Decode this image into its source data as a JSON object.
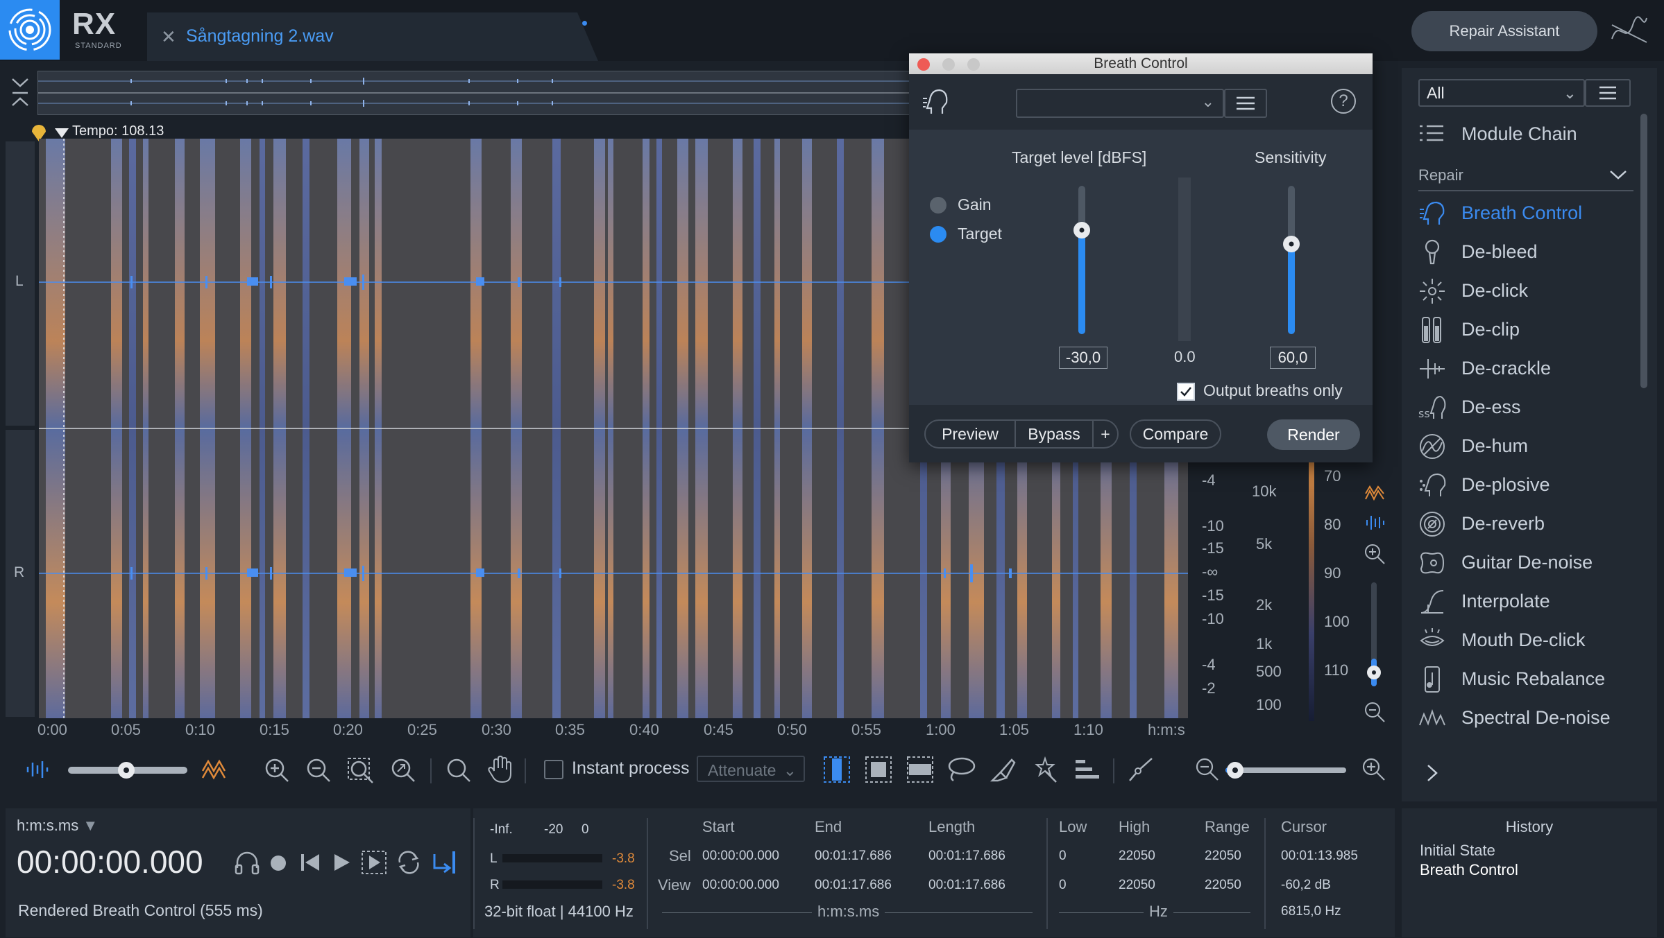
{
  "app": {
    "logo_text": "RX",
    "logo_sub": "STANDARD",
    "file_tab": "Sångtagning 2.wav",
    "repair_assistant": "Repair Assistant"
  },
  "timeline": {
    "tempo": "Tempo: 108.13",
    "time_ticks": [
      "0:00",
      "0:05",
      "0:10",
      "0:15",
      "0:20",
      "0:25",
      "0:30",
      "0:35",
      "0:40",
      "0:45",
      "0:50",
      "0:55",
      "1:00",
      "1:05",
      "1:10"
    ],
    "time_unit": "h:m:s",
    "channels": [
      "L",
      "R"
    ],
    "db_labels": [
      "-4",
      "-10",
      "-15",
      "-∞",
      "-15",
      "-10",
      "-4",
      "-2"
    ],
    "freq_labels": [
      "10k",
      "5k",
      "2k",
      "1k",
      "500",
      "100"
    ],
    "color_labels": [
      "70",
      "80",
      "90",
      "100",
      "110"
    ]
  },
  "toolbar": {
    "instant_process": "Instant process",
    "attenuate": "Attenuate"
  },
  "transport": {
    "time_format": "h:m:s.ms",
    "current_time": "00:00:00.000",
    "status": "Rendered Breath Control (555 ms)",
    "meter_scale": [
      "-Inf.",
      "-20",
      "0"
    ],
    "meter_L": "L",
    "meter_R": "R",
    "peak_L": "-3.8",
    "peak_R": "-3.8",
    "format": "32-bit float | 44100 Hz"
  },
  "selection": {
    "headers": [
      "Start",
      "End",
      "Length",
      "Low",
      "High",
      "Range",
      "Cursor"
    ],
    "sel_label": "Sel",
    "view_label": "View",
    "sel": [
      "00:00:00.000",
      "00:01:17.686",
      "00:01:17.686",
      "0",
      "22050",
      "22050",
      "00:01:13.985"
    ],
    "view": [
      "00:00:00.000",
      "00:01:17.686",
      "00:01:17.686",
      "0",
      "22050",
      "22050",
      "-60,2 dB"
    ],
    "cursor_hz": "6815,0 Hz",
    "time_unit": "h:m:s.ms",
    "freq_unit": "Hz"
  },
  "modules": {
    "filter": "All",
    "module_chain": "Module Chain",
    "category": "Repair",
    "items": [
      "Breath Control",
      "De-bleed",
      "De-click",
      "De-clip",
      "De-crackle",
      "De-ess",
      "De-hum",
      "De-plosive",
      "De-reverb",
      "Guitar De-noise",
      "Interpolate",
      "Mouth De-click",
      "Music Rebalance",
      "Spectral De-noise"
    ],
    "active": "Breath Control",
    "accent": "#3b8bf0"
  },
  "history": {
    "title": "History",
    "items": [
      "Initial State",
      "Breath Control"
    ]
  },
  "breath_control": {
    "title": "Breath Control",
    "target_level_label": "Target level [dBFS]",
    "sensitivity_label": "Sensitivity",
    "mode_gain": "Gain",
    "mode_target": "Target",
    "selected_mode": "Target",
    "target_value": "-30,0",
    "meter_value": "0.0",
    "sensitivity_value": "60,0",
    "output_breaths_only": "Output breaths only",
    "output_breaths_checked": true,
    "preview": "Preview",
    "bypass": "Bypass",
    "plus": "+",
    "compare": "Compare",
    "render": "Render"
  }
}
